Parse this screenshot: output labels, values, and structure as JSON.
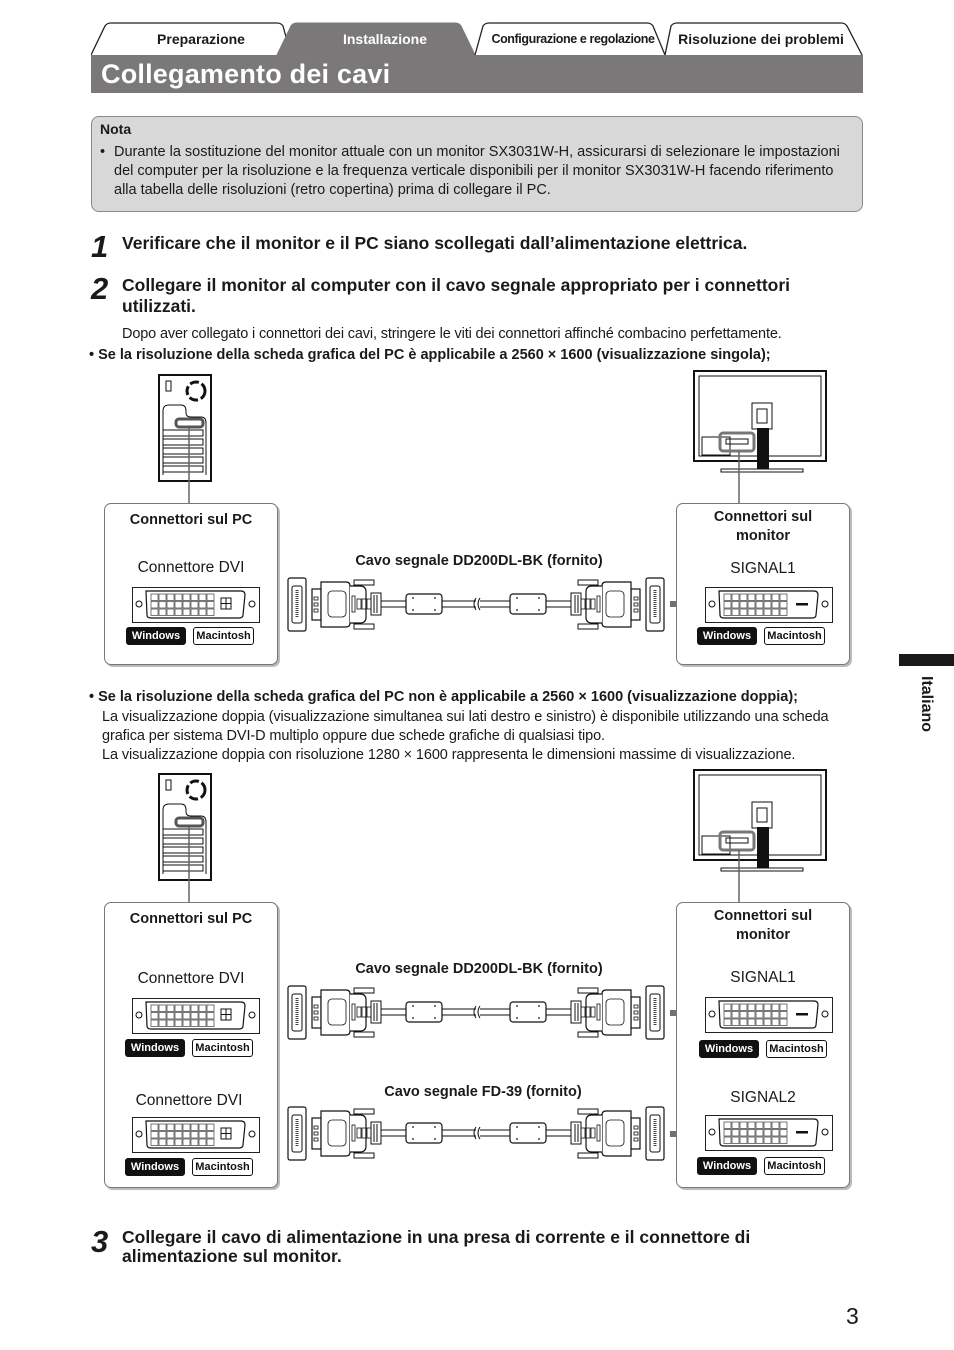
{
  "tabs": [
    {
      "label": "Preparazione",
      "active": false
    },
    {
      "label": "Installazione",
      "active": true
    },
    {
      "label": "Configurazione e regolazione",
      "active": false
    },
    {
      "label": "Risoluzione dei problemi",
      "active": false
    }
  ],
  "page_title": "Collegamento dei cavi",
  "note": {
    "title": "Nota",
    "bullet": "•",
    "text": "Durante la sostituzione del monitor attuale con un monitor SX3031W-H, assicurarsi di selezionare le impostazioni del computer per la risoluzione e la frequenza verticale disponibili per il monitor SX3031W-H facendo riferimento alla tabella delle risoluzioni (retro copertina) prima di collegare il PC."
  },
  "steps": [
    {
      "number": "1",
      "text": "Verificare che il monitor e il PC siano scollegati dall’alimentazione elettrica."
    },
    {
      "number": "2",
      "text": "Collegare il monitor al computer con il cavo segnale appropriato per i connettori utilizzati.",
      "detail": "Dopo aver collegato i connettori dei cavi, stringere le viti dei connettori affinché combacino perfettamente."
    },
    {
      "number": "3",
      "text": "Collegare il cavo di alimentazione in una presa di corrente e il connettore di alimentazione sul monitor."
    }
  ],
  "single_display": {
    "heading": "• Se la risoluzione della scheda grafica del PC è applicabile a 2560 × 1600 (visualizzazione singola);",
    "pc_box_title": "Connettori sul PC",
    "pc_connector": "Connettore DVI",
    "monitor_box_title": "Connettori sul monitor",
    "monitor_connector": "SIGNAL1",
    "cable": "Cavo segnale DD200DL-BK (fornito)",
    "os_labels": [
      "Windows",
      "Macintosh"
    ]
  },
  "dual_display": {
    "heading": "• Se la risoluzione della scheda grafica del PC non è applicabile a 2560 × 1600 (visualizzazione doppia);",
    "lines": [
      "La visualizzazione doppia (visualizzazione simultanea sui lati destro e sinistro) è disponibile utilizzando una scheda grafica per sistema DVI-D multiplo oppure due schede grafiche di qualsiasi tipo.",
      "La visualizzazione doppia con risoluzione 1280 × 1600 rappresenta le dimensioni massime di visualizzazione."
    ],
    "pc_box_title": "Connettori sul PC",
    "pc_connectors": [
      "Connettore DVI",
      "Connettore DVI"
    ],
    "monitor_box_title": "Connettori sul monitor",
    "monitor_connectors": [
      "SIGNAL1",
      "SIGNAL2"
    ],
    "cables": [
      "Cavo segnale DD200DL-BK (fornito)",
      "Cavo segnale FD-39 (fornito)"
    ],
    "os_labels": [
      "Windows",
      "Macintosh"
    ]
  },
  "side_tab_label": "Italiano",
  "page_number": "3",
  "colors": {
    "title_bar": "#7a7879",
    "note_bg": "#d8d8d8",
    "arrow": "#707070"
  }
}
